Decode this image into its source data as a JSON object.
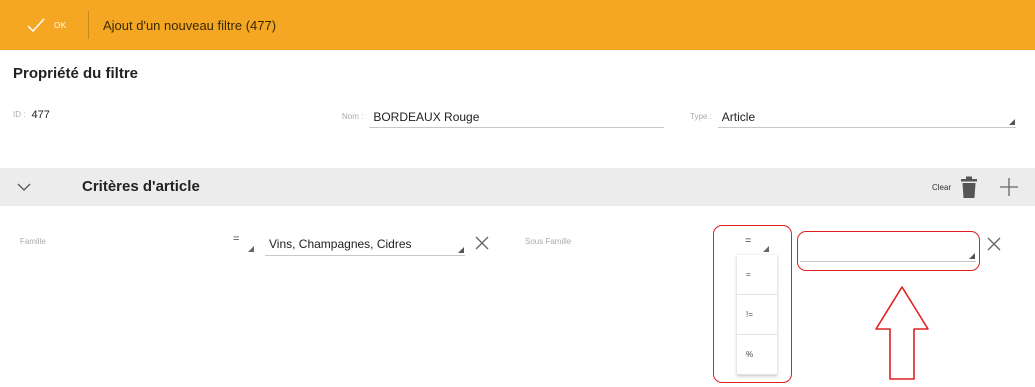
{
  "topbar": {
    "ok_label": "OK",
    "title": "Ajout d'un nouveau filtre (477)",
    "background": "#f5a623"
  },
  "section": {
    "title": "Propriété du filtre"
  },
  "properties": {
    "id_label": "ID :",
    "id_value": "477",
    "name_label": "Nom :",
    "name_value": "BORDEAUX Rouge",
    "type_label": "Type :",
    "type_value": "Article"
  },
  "criteria": {
    "title": "Critères d'article",
    "clear_label": "Clear",
    "rows": [
      {
        "label": "Famille",
        "operator": "=",
        "value": "Vins, Champagnes, Cidres"
      },
      {
        "label": "Sous Famille",
        "operator": "=",
        "value": ""
      }
    ],
    "operator_options": [
      "=",
      "!=",
      "%"
    ]
  },
  "icons": {
    "ok": "check-icon",
    "collapse": "chevron-down-icon",
    "delete": "trash-icon",
    "add": "plus-icon",
    "remove": "close-icon"
  },
  "annotation_color": "#e02020"
}
